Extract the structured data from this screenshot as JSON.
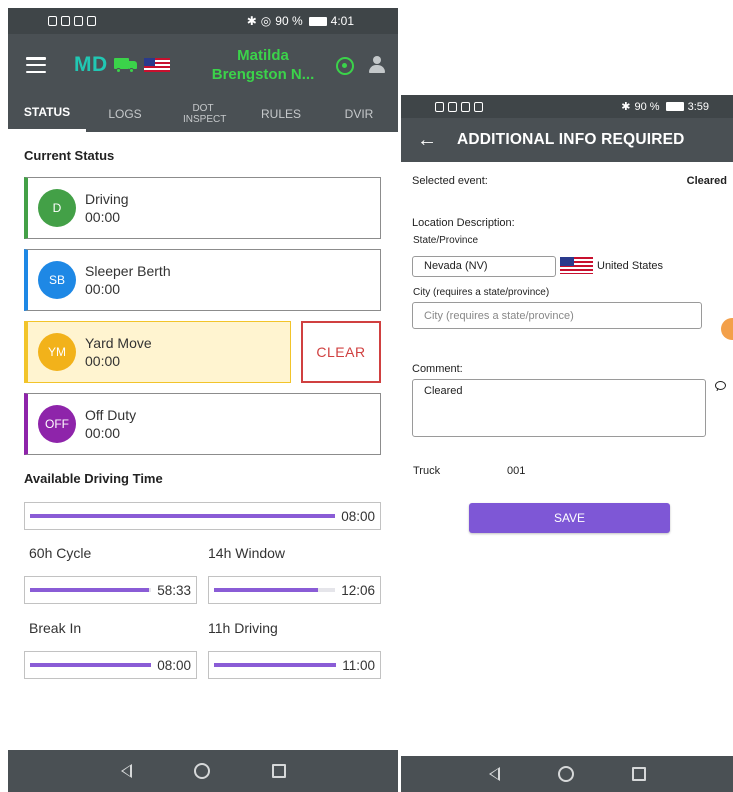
{
  "left": {
    "statusbar": {
      "battery": "90 %",
      "time": "4:01"
    },
    "appbar": {
      "logo": "MD",
      "driver_name_line1": "Matilda",
      "driver_name_line2": "Brengston N..."
    },
    "tabs": [
      "STATUS",
      "LOGS",
      "DOT INSPECT",
      "RULES",
      "DVIR"
    ],
    "current_status_title": "Current Status",
    "statuses": [
      {
        "code": "D",
        "label": "Driving",
        "time": "00:00",
        "color": "#43a047"
      },
      {
        "code": "SB",
        "label": "Sleeper Berth",
        "time": "00:00",
        "color": "#1e88e5"
      },
      {
        "code": "YM",
        "label": "Yard Move",
        "time": "00:00",
        "color": "#f2b21a"
      },
      {
        "code": "OFF",
        "label": "Off Duty",
        "time": "00:00",
        "color": "#8e24aa"
      }
    ],
    "clear_label": "CLEAR",
    "available_title": "Available Driving Time",
    "timers": {
      "total": {
        "value": "08:00",
        "fill": 1.0
      },
      "cycle": {
        "label": "60h Cycle",
        "value": "58:33",
        "fill": 0.98
      },
      "window": {
        "label": "14h Window",
        "value": "12:06",
        "fill": 0.86
      },
      "break": {
        "label": "Break In",
        "value": "08:00",
        "fill": 1.0
      },
      "driving": {
        "label": "11h Driving",
        "value": "11:00",
        "fill": 1.0
      }
    }
  },
  "right": {
    "statusbar": {
      "battery": "90 %",
      "time": "3:59"
    },
    "title": "ADDITIONAL INFO REQUIRED",
    "selected_event_label": "Selected event:",
    "selected_event_value": "Cleared",
    "location_label": "Location Description:",
    "state_label": "State/Province",
    "state_value": "Nevada (NV)",
    "country": "United States",
    "city_label": "City (requires a state/province)",
    "city_placeholder": "City (requires a state/province)",
    "comment_label": "Comment:",
    "comment_value": "Cleared",
    "truck_label": "Truck",
    "truck_value": "001",
    "save_label": "SAVE"
  },
  "colors": {
    "accent": "#7e57d6",
    "appbar": "#4a5054",
    "brand_green": "#3bd34a",
    "clear_red": "#d04040"
  }
}
